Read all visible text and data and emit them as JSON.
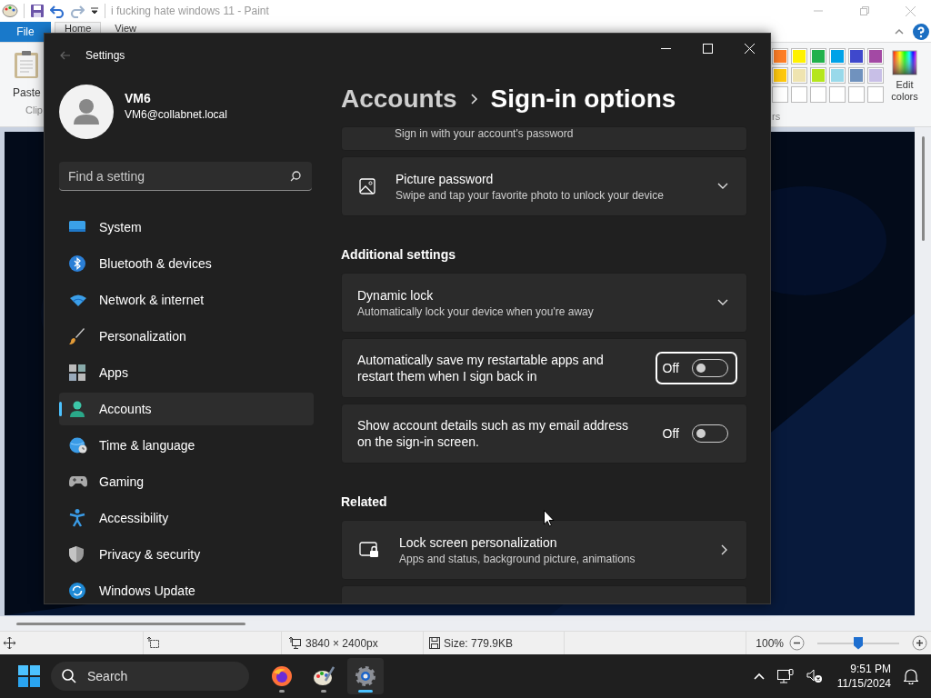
{
  "paint": {
    "title": "i fucking hate windows 11 - Paint",
    "file_menu": "File",
    "tabs": [
      {
        "label": "Home",
        "selected": true
      },
      {
        "label": "View",
        "selected": false
      }
    ],
    "ribbon": {
      "paste": "Paste",
      "clipboard_group": "Clip",
      "colors_group": "rs",
      "edit_colors": "Edit colors"
    },
    "palette": [
      {
        "color": "#ff7f27"
      },
      {
        "color": "#fff200"
      },
      {
        "color": "#22b14c"
      },
      {
        "color": "#00a2e8"
      },
      {
        "color": "#3f48cc"
      },
      {
        "color": "#a349a4"
      },
      {
        "color": "#ffc90e"
      },
      {
        "color": "#efe4b0"
      },
      {
        "color": "#b5e61d"
      },
      {
        "color": "#99d9ea"
      },
      {
        "color": "#7092be"
      },
      {
        "color": "#c8bfe7"
      },
      {
        "color": "#ffffff"
      },
      {
        "color": "#ffffff"
      },
      {
        "color": "#ffffff"
      },
      {
        "color": "#ffffff"
      },
      {
        "color": "#ffffff"
      },
      {
        "color": "#ffffff"
      }
    ],
    "status_bar": {
      "dimensions": "3840 × 2400px",
      "size": "Size: 779.9KB",
      "zoom": "100%",
      "zoom_slider": {
        "level": 0.5
      }
    }
  },
  "settings": {
    "title": "Settings",
    "user": {
      "name": "VM6",
      "email": "VM6@collabnet.local"
    },
    "search": {
      "placeholder": "Find a setting"
    },
    "nav": [
      {
        "label": "System",
        "selected": false
      },
      {
        "label": "Bluetooth & devices",
        "selected": false
      },
      {
        "label": "Network & internet",
        "selected": false
      },
      {
        "label": "Personalization",
        "selected": false
      },
      {
        "label": "Apps",
        "selected": false
      },
      {
        "label": "Accounts",
        "selected": true
      },
      {
        "label": "Time & language",
        "selected": false
      },
      {
        "label": "Gaming",
        "selected": false
      },
      {
        "label": "Accessibility",
        "selected": false
      },
      {
        "label": "Privacy & security",
        "selected": false
      },
      {
        "label": "Windows Update",
        "selected": false
      }
    ],
    "breadcrumb": {
      "parent": "Accounts",
      "current": "Sign-in options"
    },
    "content": [
      {
        "kind": "partial",
        "subtitle": "Sign in with your account's password"
      },
      {
        "kind": "expander",
        "title": "Picture password",
        "subtitle": "Swipe and tap your favorite photo to unlock your device",
        "expanded": false
      },
      {
        "kind": "heading",
        "title": "Additional settings"
      },
      {
        "kind": "expander",
        "title": "Dynamic lock",
        "subtitle": "Automatically lock your device when you're away",
        "expanded": false
      },
      {
        "kind": "toggle",
        "title": "Automatically save my restartable apps and restart them when I sign back in",
        "state_label": "Off",
        "on": false,
        "focused": true
      },
      {
        "kind": "toggle",
        "title": "Show account details such as my email address on the sign-in screen.",
        "state_label": "Off",
        "on": false,
        "focused": false
      },
      {
        "kind": "heading",
        "title": "Related"
      },
      {
        "kind": "link",
        "title": "Lock screen personalization",
        "subtitle": "Apps and status, background picture, animations"
      }
    ]
  },
  "taskbar": {
    "search": {
      "placeholder": "Search"
    },
    "apps": [
      {
        "active": false
      },
      {
        "active": false
      },
      {
        "active": true
      }
    ],
    "clock": {
      "time": "9:51 PM",
      "date": "11/15/2024"
    }
  }
}
